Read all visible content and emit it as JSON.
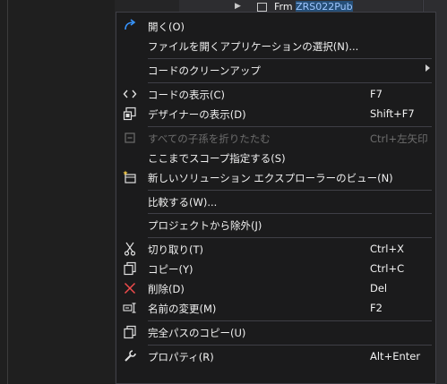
{
  "background": {
    "file_name_prefix": "Frm",
    "file_name_selected": "ZRS022Pub"
  },
  "menu": {
    "items": [
      {
        "label": "開く(O)",
        "shortcut": "",
        "icon": "open-arrow-icon"
      },
      {
        "label": "ファイルを開くアプリケーションの選択(N)...",
        "shortcut": ""
      },
      {
        "label": "コードのクリーンアップ",
        "shortcut": ""
      },
      {
        "label": "コードの表示(C)",
        "shortcut": "F7",
        "icon": "code-icon"
      },
      {
        "label": "デザイナーの表示(D)",
        "shortcut": "Shift+F7",
        "icon": "designer-icon"
      },
      {
        "label": "すべての子孫を折りたたむ",
        "shortcut": "Ctrl+左矢印",
        "icon": "collapse-icon"
      },
      {
        "label": "ここまでスコープ指定する(S)",
        "shortcut": ""
      },
      {
        "label": "新しいソリューション エクスプローラーのビュー(N)",
        "shortcut": "",
        "icon": "new-view-icon"
      },
      {
        "label": "比較する(W)...",
        "shortcut": ""
      },
      {
        "label": "プロジェクトから除外(J)",
        "shortcut": ""
      },
      {
        "label": "切り取り(T)",
        "shortcut": "Ctrl+X",
        "icon": "scissors-icon"
      },
      {
        "label": "コピー(Y)",
        "shortcut": "Ctrl+C",
        "icon": "copy-icon"
      },
      {
        "label": "削除(D)",
        "shortcut": "Del",
        "icon": "delete-x-icon"
      },
      {
        "label": "名前の変更(M)",
        "shortcut": "F2",
        "icon": "rename-icon"
      },
      {
        "label": "完全パスのコピー(U)",
        "shortcut": "",
        "icon": "copy-path-icon"
      },
      {
        "label": "プロパティ(R)",
        "shortcut": "Alt+Enter",
        "icon": "wrench-icon"
      }
    ]
  },
  "colors": {
    "menu_bg": "#1b1b1c",
    "accent_blue": "#3794ff",
    "delete_red": "#f14c4c"
  }
}
